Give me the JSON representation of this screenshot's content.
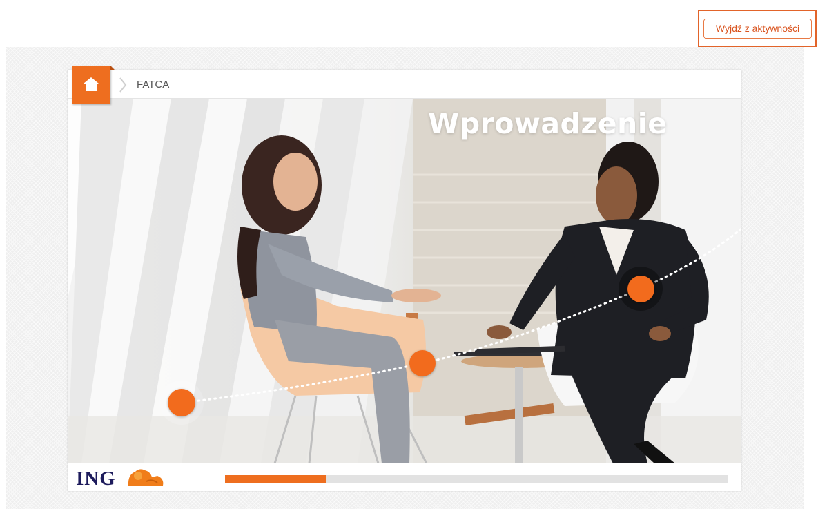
{
  "exit_button": {
    "label": "Wyjdź z aktywności"
  },
  "breadcrumb": {
    "home_icon": "home-icon",
    "separator_icon": "chevron-right-icon",
    "current": "FATCA"
  },
  "scene": {
    "title": "Wprowadzenie",
    "hotspot_count": 3
  },
  "footer": {
    "logo_text": "ING",
    "logo_icon": "lion-icon"
  },
  "progress": {
    "fraction": 0.2
  },
  "colors": {
    "accent": "#ee6e1f",
    "brand_navy": "#1d1b5c",
    "exit_border": "#e2642a"
  }
}
